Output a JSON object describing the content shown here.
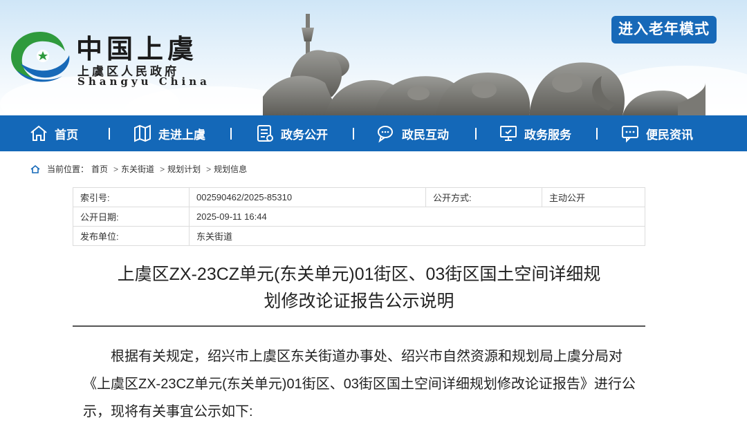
{
  "header": {
    "site_name": "中国上虞",
    "site_name_sub": "上虞区人民政府",
    "site_name_en": "Shangyu China",
    "elder_mode_label": "进入老年模式",
    "colors": {
      "brand_blue": "#1468b8",
      "logo_green": "#2f9a3d",
      "logo_blue": "#1769b8"
    }
  },
  "nav": {
    "items": [
      {
        "label": "首页",
        "icon": "home-icon"
      },
      {
        "label": "走进上虞",
        "icon": "map-icon"
      },
      {
        "label": "政务公开",
        "icon": "document-icon"
      },
      {
        "label": "政民互动",
        "icon": "chat-icon"
      },
      {
        "label": "政务服务",
        "icon": "monitor-icon"
      },
      {
        "label": "便民资讯",
        "icon": "message-icon"
      }
    ]
  },
  "breadcrumb": {
    "prefix": "当前位置：",
    "items": [
      "首页",
      "东关街道",
      "规划计划",
      "规划信息"
    ],
    "separator": ">"
  },
  "meta": {
    "index_label": "索引号:",
    "index_value": "002590462/2025-85310",
    "method_label": "公开方式:",
    "method_value": "主动公开",
    "date_label": "公开日期:",
    "date_value": "2025-09-11 16:44",
    "publisher_label": "发布单位:",
    "publisher_value": "东关街道"
  },
  "article": {
    "title_line1": "上虞区ZX-23CZ单元(东关单元)01街区、03街区国土空间详细规",
    "title_line2": "划修改论证报告公示说明",
    "paragraph": "根据有关规定，绍兴市上虞区东关街道办事处、绍兴市自然资源和规划局上虞分局对《上虞区ZX-23CZ单元(东关单元)01街区、03街区国土空间详细规划修改论证报告》进行公示，现将有关事宜公示如下:"
  }
}
